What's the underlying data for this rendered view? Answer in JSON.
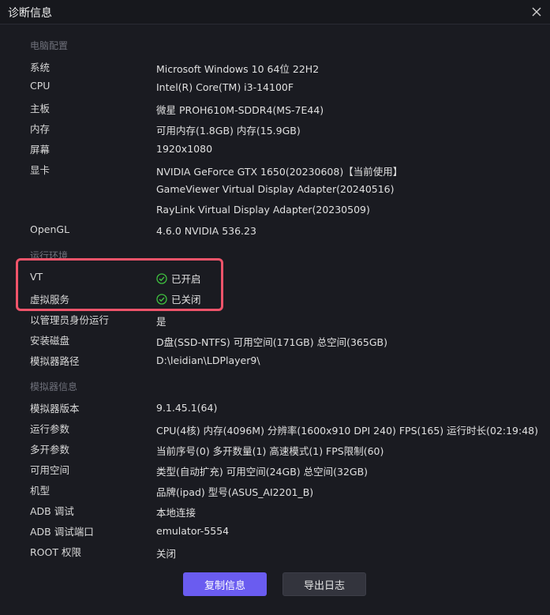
{
  "window": {
    "title": "诊断信息"
  },
  "sections": {
    "pc": "电脑配置",
    "runtime": "运行环境",
    "emulator": "模拟器信息"
  },
  "pc": {
    "system_label": "系统",
    "system_value": "Microsoft Windows 10 64位 22H2",
    "cpu_label": "CPU",
    "cpu_value": "Intel(R) Core(TM) i3-14100F",
    "board_label": "主板",
    "board_value": "微星 PROH610M-SDDR4(MS-7E44)",
    "memory_label": "内存",
    "memory_value": "可用内存(1.8GB) 内存(15.9GB)",
    "screen_label": "屏幕",
    "screen_value": "1920x1080",
    "gpu_label": "显卡",
    "gpu_values": [
      "NVIDIA GeForce GTX 1650(20230608)【当前使用】",
      "GameViewer Virtual Display Adapter(20240516)",
      "RayLink Virtual Display Adapter(20230509)"
    ],
    "opengl_label": "OpenGL",
    "opengl_value": "4.6.0 NVIDIA 536.23"
  },
  "runtime": {
    "vt_label": "VT",
    "vt_value": "已开启",
    "virt_label": "虚拟服务",
    "virt_value": "已关闭",
    "admin_label": "以管理员身份运行",
    "admin_value": "是",
    "disk_label": "安装磁盘",
    "disk_value": "D盘(SSD-NTFS) 可用空间(171GB) 总空间(365GB)",
    "path_label": "模拟器路径",
    "path_value": "D:\\leidian\\LDPlayer9\\"
  },
  "emulator": {
    "version_label": "模拟器版本",
    "version_value": "9.1.45.1(64)",
    "params_label": "运行参数",
    "params_value": "CPU(4核) 内存(4096M) 分辨率(1600x910 DPI 240) FPS(165) 运行时长(02:19:48)",
    "multi_label": "多开参数",
    "multi_value": "当前序号(0) 多开数量(1) 高速模式(1) FPS限制(60)",
    "space_label": "可用空间",
    "space_value": "类型(自动扩充) 可用空间(24GB) 总空间(32GB)",
    "model_label": "机型",
    "model_value": "品牌(ipad) 型号(ASUS_AI2201_B)",
    "adb_label": "ADB 调试",
    "adb_value": "本地连接",
    "adbport_label": "ADB 调试端口",
    "adbport_value": "emulator-5554",
    "root_label": "ROOT 权限",
    "root_value": "关闭"
  },
  "buttons": {
    "copy": "复制信息",
    "export": "导出日志"
  },
  "colors": {
    "accent": "#6a5cf0",
    "ok": "#3fbf3f",
    "highlight": "#f0546a"
  }
}
